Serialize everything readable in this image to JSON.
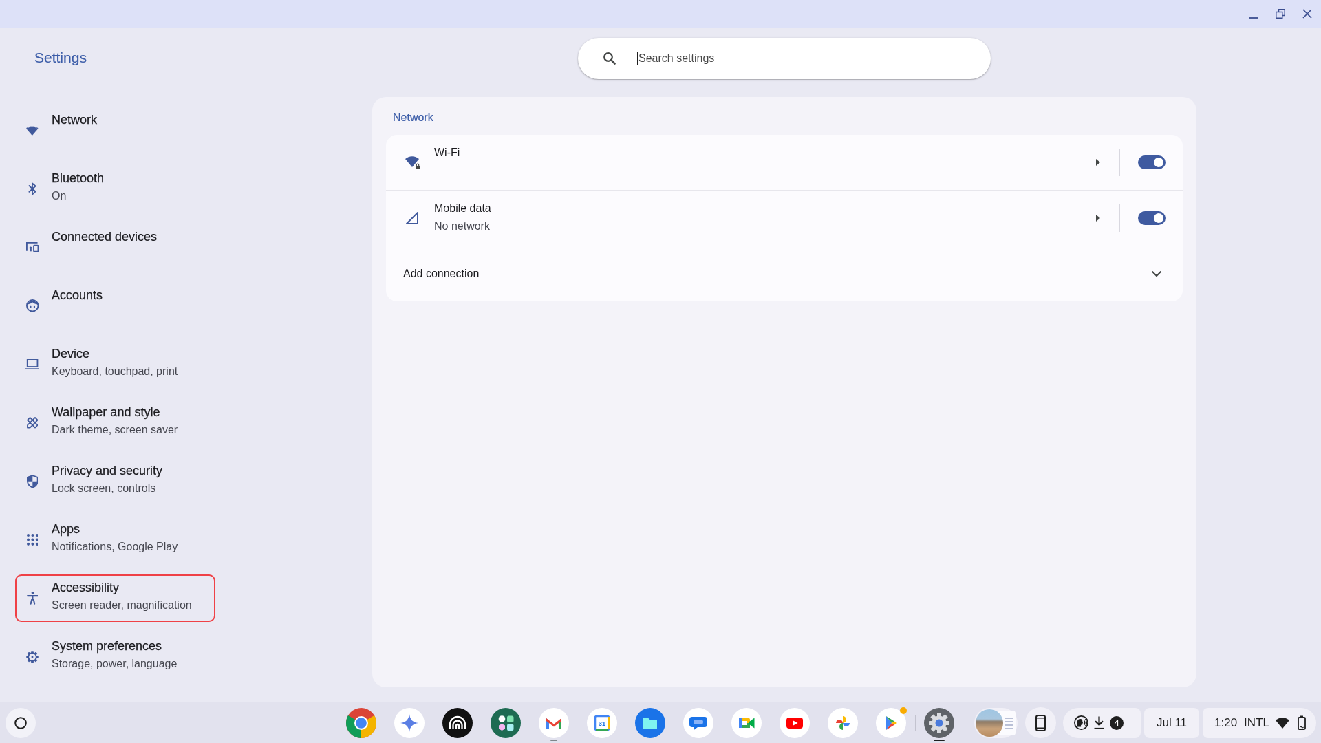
{
  "window": {
    "app_title": "Settings"
  },
  "search": {
    "placeholder": "Search settings",
    "focused": true
  },
  "sidebar": {
    "items": [
      {
        "title": "Network",
        "highlighted": false
      },
      {
        "title": "Bluetooth",
        "subtitle": "On",
        "highlighted": false
      },
      {
        "title": "Connected devices",
        "highlighted": false
      },
      {
        "title": "Accounts",
        "highlighted": false
      },
      {
        "title": "Device",
        "subtitle": "Keyboard, touchpad, print",
        "highlighted": false
      },
      {
        "title": "Wallpaper and style",
        "subtitle": "Dark theme, screen saver",
        "highlighted": false
      },
      {
        "title": "Privacy and security",
        "subtitle": "Lock screen, controls",
        "highlighted": false
      },
      {
        "title": "Apps",
        "subtitle": "Notifications, Google Play",
        "highlighted": false
      },
      {
        "title": "Accessibility",
        "subtitle": "Screen reader, magnification",
        "highlighted": true
      },
      {
        "title": "System preferences",
        "subtitle": "Storage, power, language",
        "highlighted": false
      }
    ]
  },
  "network": {
    "heading": "Network",
    "rows": [
      {
        "kind": "toggle",
        "title": "Wi-Fi",
        "on": true
      },
      {
        "kind": "toggle",
        "title": "Mobile data",
        "subtitle": "No network",
        "on": true
      },
      {
        "kind": "expander",
        "title": "Add connection",
        "expanded": false
      }
    ]
  },
  "shelf": {
    "apps": [
      {
        "running": false,
        "notification": false
      },
      {
        "running": false,
        "notification": false
      },
      {
        "running": false,
        "notification": false
      },
      {
        "running": false,
        "notification": false
      },
      {
        "running": true,
        "active": false,
        "notification": false
      },
      {
        "glyph": "31",
        "running": false,
        "notification": false
      },
      {
        "running": false,
        "notification": false
      },
      {
        "running": false,
        "notification": false
      },
      {
        "running": false,
        "notification": false
      },
      {
        "running": false,
        "notification": false
      },
      {
        "running": false,
        "notification": false
      },
      {
        "running": false,
        "notification": true
      },
      {
        "running": true,
        "active": true,
        "notification": false
      }
    ],
    "tray": {
      "notification_count": "4",
      "date": "Jul 11",
      "time": "1:20",
      "input_method": "INTL"
    }
  }
}
